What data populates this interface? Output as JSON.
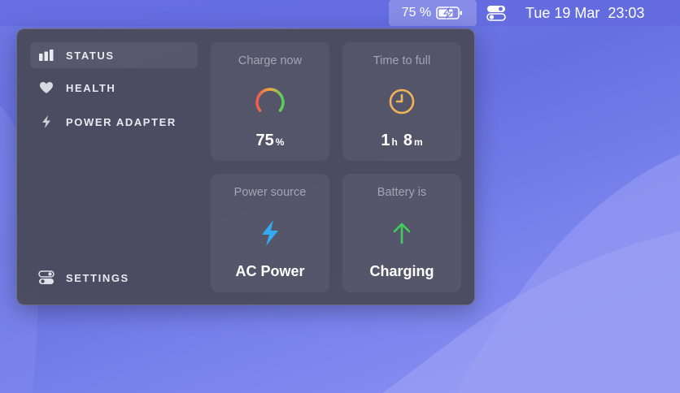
{
  "menubar": {
    "battery_percent": "75 %",
    "date": "Tue 19 Mar",
    "time": "23:03"
  },
  "sidebar": {
    "items": [
      {
        "label": "STATUS",
        "icon": "bar-chart-icon",
        "active": true
      },
      {
        "label": "HEALTH",
        "icon": "heart-icon",
        "active": false
      },
      {
        "label": "POWER ADAPTER",
        "icon": "lightning-icon",
        "active": false
      }
    ],
    "settings_label": "SETTINGS"
  },
  "cards": {
    "charge": {
      "title": "Charge now",
      "value": "75",
      "unit": "%",
      "level": 0.75
    },
    "time_to_full": {
      "title": "Time to full",
      "hours": "1",
      "hours_unit": "h",
      "minutes": "8",
      "minutes_unit": "m"
    },
    "power_source": {
      "title": "Power source",
      "value": "AC Power"
    },
    "battery_state": {
      "title": "Battery is",
      "value": "Charging"
    }
  },
  "colors": {
    "accent_blue": "#36a9f0",
    "accent_green": "#3fcf5a",
    "clock_orange": "#f0b35a"
  }
}
